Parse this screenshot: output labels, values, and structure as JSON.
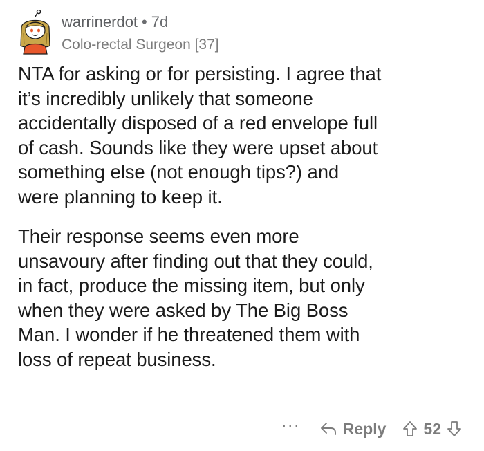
{
  "comment": {
    "username": "warrinerdot",
    "separator": "•",
    "age": "7d",
    "flair": "Colo-rectal Surgeon [37]",
    "paragraphs": [
      {
        "lines": [
          "NTA for asking or for persisting. I agree that",
          "it’s incredibly unlikely that someone",
          "accidentally disposed of a red envelope full",
          "of cash. Sounds like they were upset about",
          "something else (not enough tips?) and",
          "were planning to keep it."
        ]
      },
      {
        "lines": [
          "Their response seems even more",
          "unsavoury after finding out that they could,",
          "in fact, produce the missing item, but only",
          "when they were asked by The Big Boss",
          "Man. I wonder if he threatened them with",
          "loss of repeat business."
        ]
      }
    ],
    "actions": {
      "more_label": "···",
      "reply_label": "Reply",
      "score": "52"
    }
  },
  "icons": {
    "avatar": "snoo-avatar-with-long-hair",
    "reply": "reply-arrow-icon",
    "upvote": "upvote-arrow-icon",
    "downvote": "downvote-arrow-icon"
  },
  "colors": {
    "text": "#1c1c1c",
    "meta": "#7c7c7c",
    "avatar_hair": "#c9a74a",
    "avatar_shirt": "#e8582c"
  }
}
